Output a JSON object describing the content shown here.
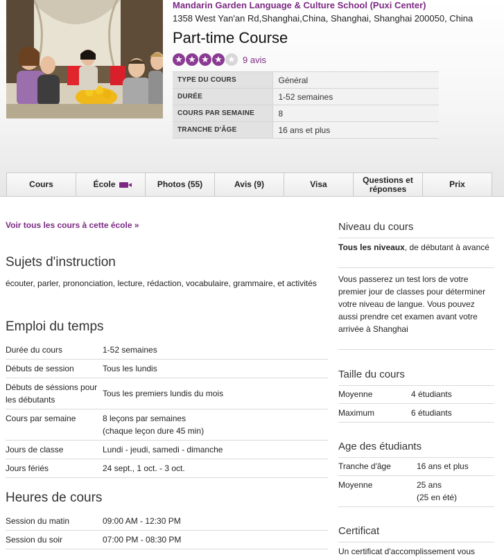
{
  "school": {
    "name": "Mandarin Garden Language & Culture School (Puxi Center)",
    "address": "1358 West Yan'an Rd,Shanghai,China, Shanghai, Shanghai 200050, China"
  },
  "course": {
    "title": "Part-time Course",
    "rating": 4,
    "rating_max": 5,
    "reviews_link": "9 avis"
  },
  "summary": [
    {
      "label": "TYPE DU COURS",
      "value": "Général"
    },
    {
      "label": "DURÉE",
      "value": "1-52 semaines"
    },
    {
      "label": "COURS PAR SEMAINE",
      "value": "8"
    },
    {
      "label": "TRANCHE D'ÂGE",
      "value": "16 ans et plus"
    }
  ],
  "tabs": [
    {
      "label": "Cours"
    },
    {
      "label": "École",
      "icon": "video-camera-icon"
    },
    {
      "label": "Photos (55)"
    },
    {
      "label": "Avis (9)"
    },
    {
      "label": "Visa"
    },
    {
      "label": "Questions et réponses"
    },
    {
      "label": "Prix"
    }
  ],
  "main": {
    "all_courses_link": "Voir tous les cours à cette école »",
    "subjects": {
      "heading": "Sujets d'instruction",
      "text": "écouter, parler, prononciation, lecture, rédaction, vocabulaire, grammaire, et activités"
    },
    "schedule": {
      "heading": "Emploi du temps",
      "rows": [
        {
          "k": "Durée du cours",
          "v": "1-52 semaines"
        },
        {
          "k": "Débuts de session",
          "v": "Tous les lundis"
        },
        {
          "k": "Débuts de séssions pour les débutants",
          "v": "Tous les premiers lundis du mois"
        },
        {
          "k": "Cours par semaine",
          "v": "8 leçons par semaines",
          "v2": "(chaque leçon dure 45 min)"
        },
        {
          "k": "Jours de classe",
          "v": "Lundi - jeudi, samedi - dimanche"
        },
        {
          "k": "Jours fériés",
          "v": "24 sept., 1 oct. - 3 oct."
        }
      ]
    },
    "hours": {
      "heading": "Heures de cours",
      "rows": [
        {
          "k": "Session du matin",
          "v": "09:00 AM - 12:30 PM"
        },
        {
          "k": "Session du soir",
          "v": "07:00 PM - 08:30 PM"
        }
      ]
    }
  },
  "sidebar": {
    "level": {
      "heading": "Niveau du cours",
      "bold": "Tous les niveaux",
      "rest": ", de débutant à avancé",
      "note": "Vous passerez un test lors de votre premier jour de classes pour déterminer votre niveau de langue. Vous pouvez aussi prendre cet examen avant votre arrivée à Shanghai"
    },
    "size": {
      "heading": "Taille du cours",
      "rows": [
        {
          "k": "Moyenne",
          "v": "4 étudiants"
        },
        {
          "k": "Maximum",
          "v": "6 étudiants"
        }
      ]
    },
    "age": {
      "heading": "Age des étudiants",
      "rows": [
        {
          "k": "Tranche d'âge",
          "v": "16 ans et plus"
        },
        {
          "k": "Moyenne",
          "v": "25 ans",
          "v2": "(25 en été)"
        }
      ]
    },
    "certificate": {
      "heading": "Certificat",
      "text": "Un certificat d'accomplissement vous"
    }
  },
  "colors": {
    "accent": "#7b2982",
    "star_empty": "#d7d7d7"
  }
}
